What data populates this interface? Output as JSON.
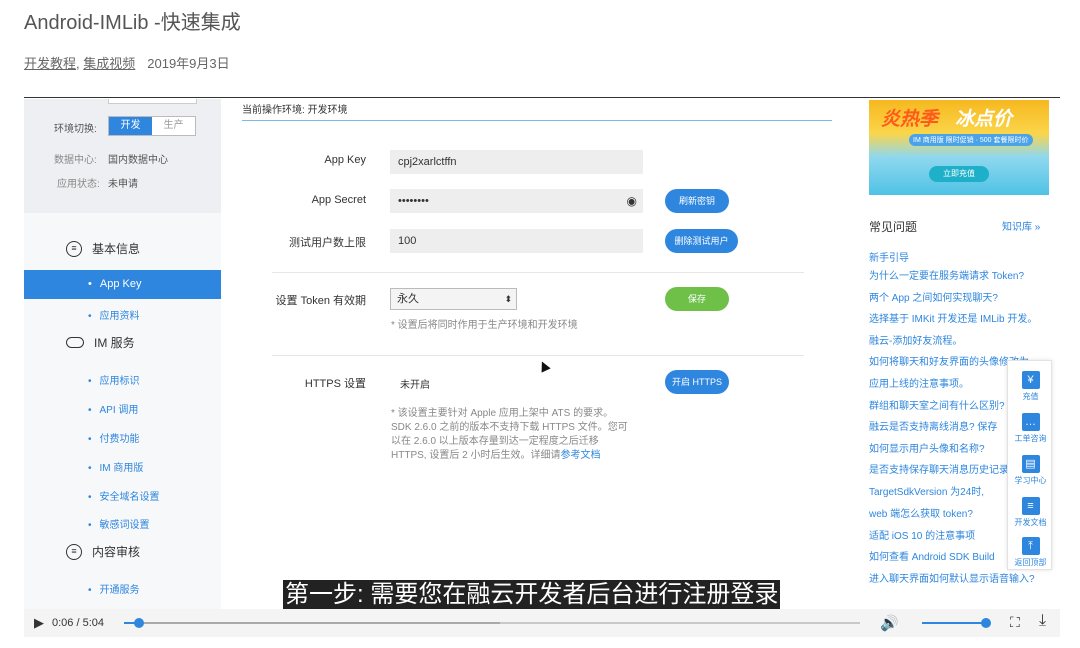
{
  "article": {
    "title": "Android-IMLib -快速集成",
    "categories": [
      "开发教程",
      "集成视频"
    ],
    "date": "2019年9月3日"
  },
  "left_panel": {
    "env_label": "环境切换:",
    "env_dev": "开发",
    "env_prod": "生产",
    "datacenter_label": "数据中心:",
    "datacenter_value": "国内数据中心",
    "status_label": "应用状态:",
    "status_value": "未申请",
    "sections": [
      {
        "title": "基本信息",
        "icon": "info-icon",
        "items": [
          "App Key",
          "应用资料"
        ]
      },
      {
        "title": "IM 服务",
        "icon": "cloud-icon",
        "items": [
          "应用标识",
          "API 调用",
          "付费功能",
          "IM 商用版",
          "安全域名设置",
          "敏感词设置"
        ]
      },
      {
        "title": "内容审核",
        "icon": "audit-icon",
        "items": [
          "开通服务"
        ]
      }
    ],
    "active_item": "App Key"
  },
  "form": {
    "current_env": "当前操作环境: 开发环境",
    "app_key_label": "App Key",
    "app_key_value": "cpj2xarlctffn",
    "app_secret_label": "App Secret",
    "app_secret_value": "••••••••",
    "refresh_secret": "刷新密钥",
    "test_users_label": "测试用户数上限",
    "test_users_value": "100",
    "delete_test_users": "删除测试用户",
    "token_label": "设置 Token 有效期",
    "token_value": "永久",
    "save": "保存",
    "token_hint": "* 设置后将同时作用于生产环境和开发环境",
    "https_label": "HTTPS 设置",
    "https_value": "未开启",
    "https_button": "开启 HTTPS",
    "https_hint_lines": [
      "* 该设置主要针对 Apple 应用上架中 ATS 的要求。",
      "SDK 2.6.0 之前的版本不支持下载 HTTPS 文件。您可",
      "以在 2.6.0 以上版本存量到达一定程度之后迁移",
      "HTTPS, 设置后 2 小时后生效。详细请"
    ],
    "https_hint_link": "参考文档"
  },
  "right_panel": {
    "banner_title_a": "炎热季",
    "banner_title_b": "冰点价",
    "banner_sub": "IM 商用版 限时促销 · 500 套餐限时价",
    "banner_cta": "立即充值",
    "faq_title": "常见问题",
    "faq_more": "知识库 »",
    "faq_items": [
      "新手引导",
      "为什么一定要在服务端请求 Token?",
      "两个 App 之间如何实现聊天?",
      "选择基于 IMKit 开发还是 IMLib 开发。",
      "融云-添加好友流程。",
      "如何将聊天和好友界面的头像修改为",
      "应用上线的注意事项。",
      "群组和聊天室之间有什么区别?",
      "融云是否支持离线消息? 保存",
      "如何显示用户头像和名称?",
      "是否支持保存聊天消息历史记录",
      "TargetSdkVersion 为24时,",
      "web 端怎么获取 token?",
      "适配 iOS 10 的注意事项",
      "如何查看 Android SDK Build",
      "进入聊天界面如何默认显示语音输入?"
    ],
    "float_bar": [
      {
        "icon": "yen-icon",
        "label": "充值"
      },
      {
        "icon": "chat-icon",
        "label": "工单咨询"
      },
      {
        "icon": "book-icon",
        "label": "学习中心"
      },
      {
        "icon": "doc-icon",
        "label": "开发文档"
      },
      {
        "icon": "top-icon",
        "label": "返回顶部"
      }
    ]
  },
  "video": {
    "subtitle": "第一步: 需要您在融云开发者后台进行注册登录",
    "time": "0:06 / 5:04",
    "progress": 0.02,
    "volume": 1.0
  }
}
